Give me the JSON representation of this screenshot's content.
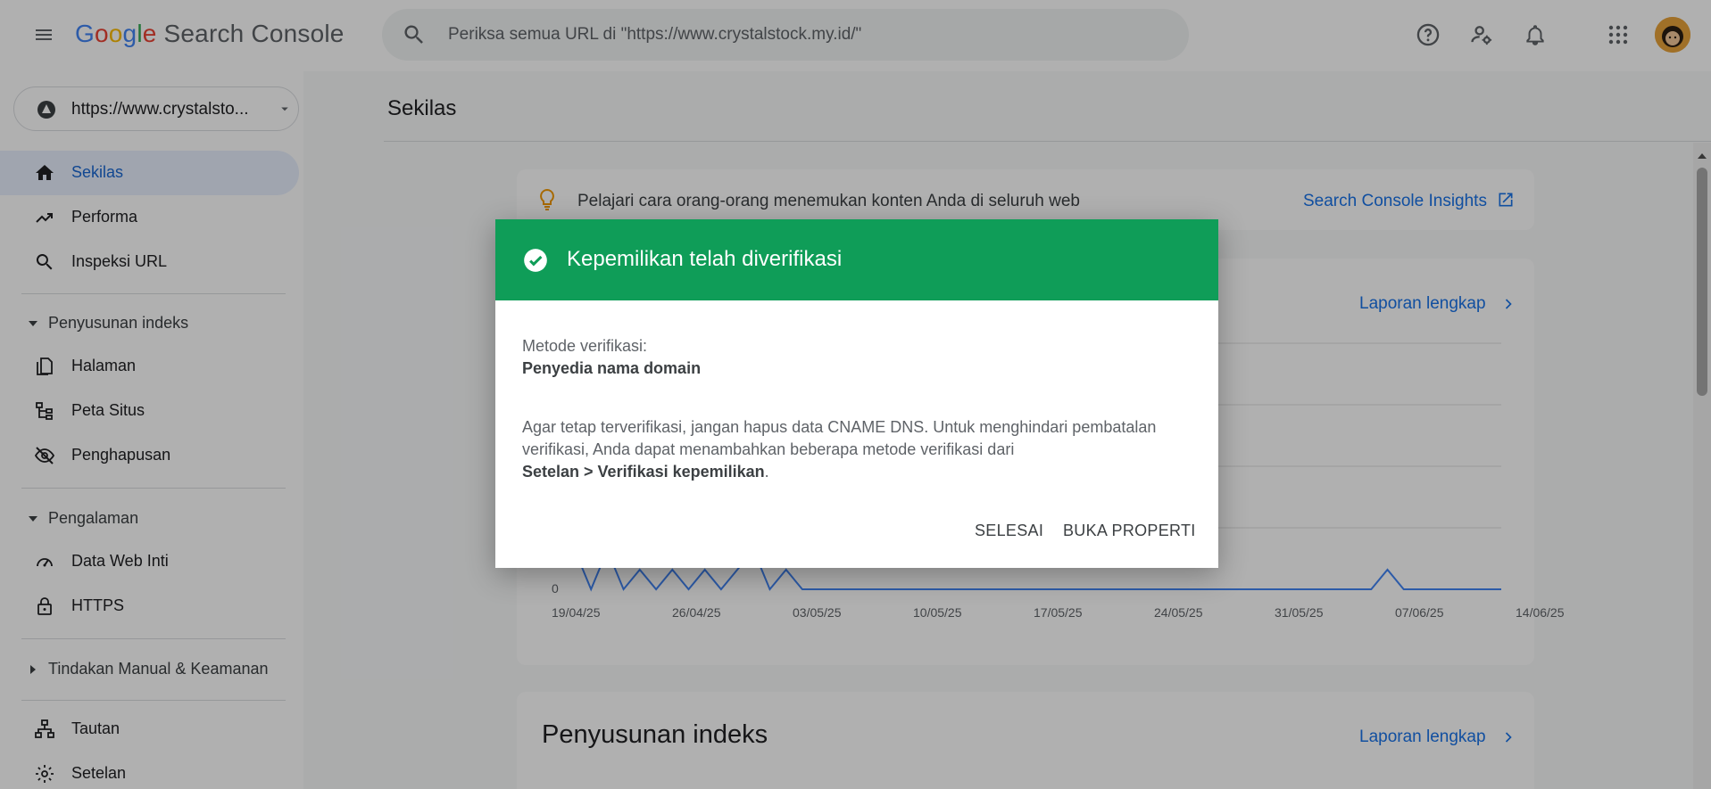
{
  "header": {
    "logo_google": [
      "G",
      "o",
      "o",
      "g",
      "l",
      "e"
    ],
    "logo_product": "Search Console",
    "search_placeholder": "Periksa semua URL di \"https://www.crystalstock.my.id/\""
  },
  "sidebar": {
    "property": "https://www.crystalsto...",
    "items": [
      {
        "label": "Sekilas",
        "icon": "home-icon",
        "active": true
      },
      {
        "label": "Performa",
        "icon": "trending-up-icon"
      },
      {
        "label": "Inspeksi URL",
        "icon": "search-icon"
      }
    ],
    "section_index": "Penyusunan indeks",
    "index_items": [
      {
        "label": "Halaman",
        "icon": "pages-icon"
      },
      {
        "label": "Peta Situs",
        "icon": "sitemap-icon"
      },
      {
        "label": "Penghapusan",
        "icon": "removal-icon"
      }
    ],
    "section_experience": "Pengalaman",
    "experience_items": [
      {
        "label": "Data Web Inti",
        "icon": "speed-icon"
      },
      {
        "label": "HTTPS",
        "icon": "lock-icon"
      }
    ],
    "section_security": "Tindakan Manual & Keamanan",
    "bottom_items": [
      {
        "label": "Tautan",
        "icon": "links-icon"
      },
      {
        "label": "Setelan",
        "icon": "settings-icon"
      }
    ]
  },
  "main": {
    "page_title": "Sekilas",
    "insight_text": "Pelajari cara orang-orang menemukan konten Anda di seluruh web",
    "insight_link": "Search Console Insights",
    "report_link": "Laporan lengkap",
    "index_title": "Penyusunan indeks",
    "index_link": "Laporan lengkap"
  },
  "chart_data": {
    "type": "line",
    "x_ticks": [
      "19/04/25",
      "26/04/25",
      "03/05/25",
      "10/05/25",
      "17/05/25",
      "24/05/25",
      "31/05/25",
      "07/06/25",
      "14/06/25"
    ],
    "y_tick_zero": "0",
    "values_visible": [
      2,
      0,
      2,
      0,
      1,
      0,
      1,
      0,
      1,
      0,
      1,
      2,
      0,
      1,
      0,
      0,
      0,
      0,
      0,
      0,
      0,
      0,
      0,
      0,
      0,
      0,
      0,
      0,
      0,
      0,
      0,
      0,
      0,
      0,
      0,
      0,
      0,
      0,
      0,
      0,
      0,
      0,
      0,
      0,
      0,
      0,
      0,
      0,
      0,
      0,
      1,
      0,
      0,
      0,
      0,
      0,
      0,
      0
    ]
  },
  "dialog": {
    "title": "Kepemilikan telah diverifikasi",
    "method_label": "Metode verifikasi:",
    "method_value": "Penyedia nama domain",
    "body_line1": "Agar tetap terverifikasi, jangan hapus data CNAME DNS. Untuk menghindari pembatalan",
    "body_line2": "verifikasi, Anda dapat menambahkan beberapa metode verifikasi dari",
    "body_line3_bold": "Setelan > Verifikasi kepemilikan",
    "body_line3_end": ".",
    "btn_done": "SELESAI",
    "btn_open": "BUKA PROPERTI"
  }
}
